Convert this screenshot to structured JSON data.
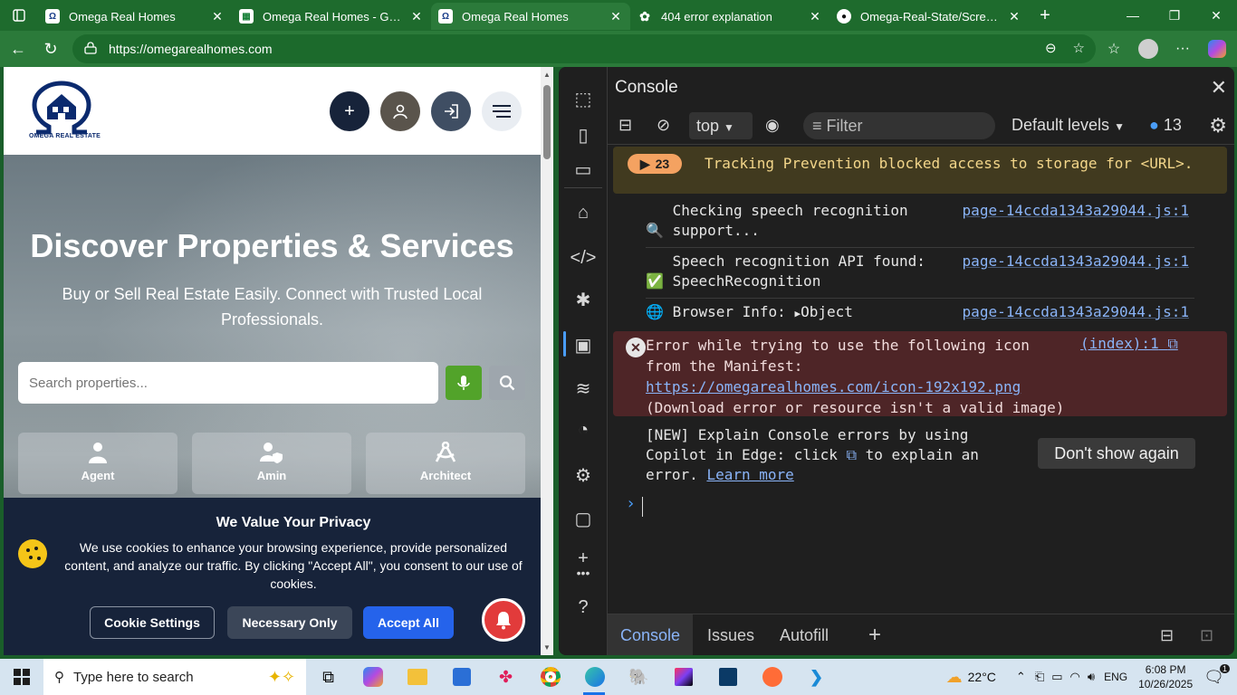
{
  "browser": {
    "tabs": [
      {
        "title": "Omega Real Homes",
        "icon": "omega-favicon",
        "active": false
      },
      {
        "title": "Omega Real Homes - Google",
        "icon": "sheets-favicon",
        "active": false
      },
      {
        "title": "Omega Real Homes",
        "icon": "omega-favicon",
        "active": true
      },
      {
        "title": "404 error explanation",
        "icon": "chatgpt-favicon",
        "active": false
      },
      {
        "title": "Omega-Real-State/Screenshot",
        "icon": "github-favicon",
        "active": false
      }
    ],
    "url": "https://omegarealhomes.com"
  },
  "site": {
    "logo_text": "OMEGA REAL ESTATE",
    "hero_title": "Discover Properties & Services",
    "hero_subtitle": "Buy or Sell Real Estate Easily. Connect with Trusted Local Professionals.",
    "search_placeholder": "Search properties...",
    "categories": [
      {
        "label": "Agent",
        "icon": "agent-icon"
      },
      {
        "label": "Amin",
        "icon": "user-shield-icon"
      },
      {
        "label": "Architect",
        "icon": "compass-drafting-icon"
      }
    ],
    "cookie": {
      "title": "We Value Your Privacy",
      "text": "We use cookies to enhance your browsing experience, provide personalized content, and analyze our traffic. By clicking \"Accept All\", you consent to our use of cookies.",
      "settings_label": "Cookie Settings",
      "necessary_label": "Necessary Only",
      "accept_label": "Accept All"
    }
  },
  "devtools": {
    "title": "Console",
    "context": "top",
    "filter_placeholder": "Filter",
    "levels": "Default levels",
    "message_count": "13",
    "warning": {
      "count": "23",
      "text": "Tracking Prevention blocked access to storage for <URL>."
    },
    "logs": [
      {
        "emoji": "🔍",
        "text": "Checking speech recognition support...",
        "source": "page-14ccda1343a29044.js:1"
      },
      {
        "emoji": "✅",
        "text": "Speech recognition API found: SpeechRecognition",
        "source": "page-14ccda1343a29044.js:1"
      },
      {
        "emoji": "🌐",
        "text": "Browser Info:",
        "object": "Object",
        "source": "page-14ccda1343a29044.js:1"
      }
    ],
    "error": {
      "text_before": "Error while trying to use the following icon from the Manifest: ",
      "link": "https://omegarealhomes.com/icon-192x192.png",
      "text_after": " (Download error or resource isn't a valid image)",
      "source": "(index):1"
    },
    "tip": {
      "text_before": "[NEW] Explain Console errors by using Copilot in Edge: click ",
      "text_after": " to explain an error. ",
      "link": "Learn more",
      "button": "Don't show again"
    },
    "bottom_tabs": [
      "Console",
      "Issues",
      "Autofill"
    ]
  },
  "taskbar": {
    "search_placeholder": "Type here to search",
    "weather": "22°C",
    "language": "ENG",
    "time": "6:08 PM",
    "date": "10/26/2025",
    "notification_count": "1"
  }
}
